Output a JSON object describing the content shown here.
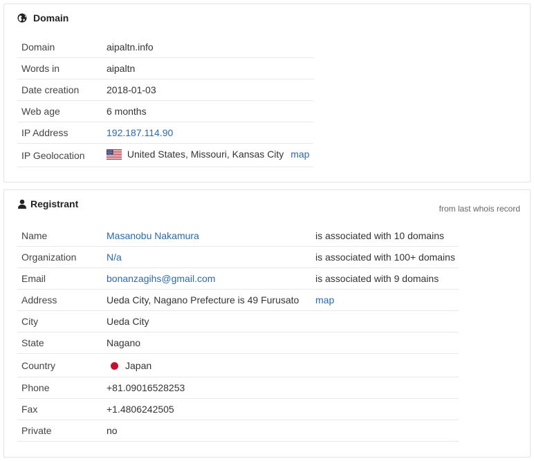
{
  "domain_panel": {
    "title": "Domain",
    "rows": [
      {
        "label": "Domain",
        "value": "aipaltn.info"
      },
      {
        "label": "Words in",
        "value": "aipaltn"
      },
      {
        "label": "Date creation",
        "value": "2018-01-03"
      },
      {
        "label": "Web age",
        "value": "6 months"
      },
      {
        "label": "IP Address",
        "value": "192.187.114.90"
      },
      {
        "label": "IP Geolocation",
        "value": "United States, Missouri, Kansas City",
        "link": "map"
      }
    ]
  },
  "registrant_panel": {
    "title": "Registrant",
    "note": "from last whois record",
    "rows": [
      {
        "label": "Name",
        "value": "Masanobu Nakamura",
        "assoc": "is associated with 10 domains"
      },
      {
        "label": "Organization",
        "value": "N/a",
        "assoc": "is associated with 100+ domains"
      },
      {
        "label": "Email",
        "value": "bonanzagihs@gmail.com",
        "assoc": "is associated with 9 domains"
      },
      {
        "label": "Address",
        "value": "Ueda City, Nagano Prefecture is 49 Furusato",
        "link": "map"
      },
      {
        "label": "City",
        "value": "Ueda City"
      },
      {
        "label": "State",
        "value": "Nagano"
      },
      {
        "label": "Country",
        "value": "Japan"
      },
      {
        "label": "Phone",
        "value": "+81.09016528253"
      },
      {
        "label": "Fax",
        "value": "+1.4806242505"
      },
      {
        "label": "Private",
        "value": "no"
      }
    ]
  },
  "icons": {
    "domain": "globe-icon",
    "registrant": "user-icon",
    "us_flag": "us-flag-icon",
    "japan_flag": "japan-flag-icon"
  },
  "colors": {
    "link": "#2a6aad",
    "japan_flag": "#c8102e"
  }
}
